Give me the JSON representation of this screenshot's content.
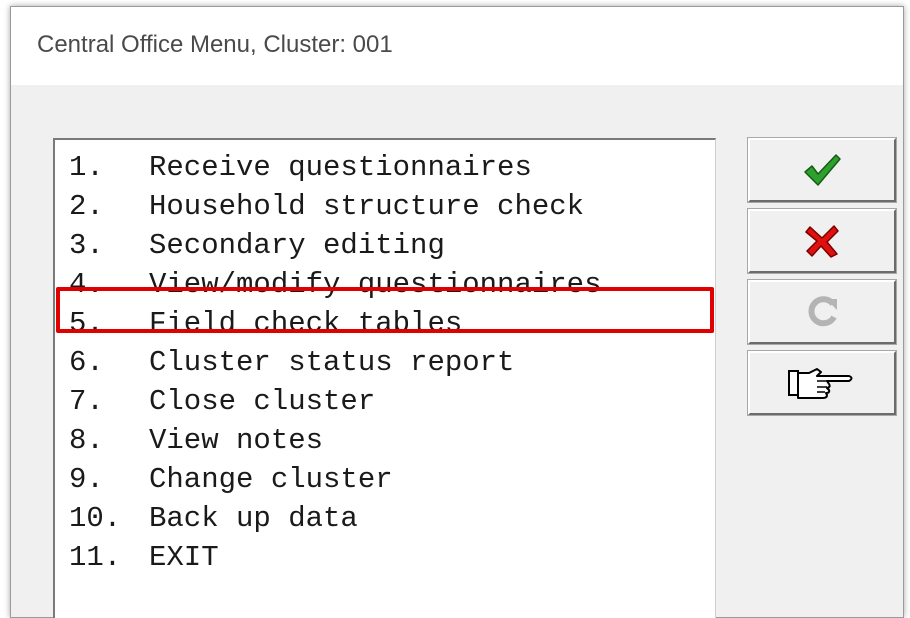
{
  "window": {
    "title": "Central Office Menu, Cluster: 001"
  },
  "menu": {
    "items": [
      {
        "num": "1.",
        "label": "Receive questionnaires"
      },
      {
        "num": "2.",
        "label": "Household structure check"
      },
      {
        "num": "3.",
        "label": "Secondary editing"
      },
      {
        "num": "4.",
        "label": "View/modify questionnaires"
      },
      {
        "num": "5.",
        "label": "Field check tables"
      },
      {
        "num": "6.",
        "label": "Cluster status report"
      },
      {
        "num": "7.",
        "label": "Close cluster"
      },
      {
        "num": "8.",
        "label": "View notes"
      },
      {
        "num": "9.",
        "label": "Change cluster"
      },
      {
        "num": "10.",
        "label": "Back up data"
      },
      {
        "num": "11.",
        "label": "EXIT"
      }
    ],
    "highlighted_index": 4,
    "highlight_color": "#e00000"
  },
  "toolbar": {
    "buttons": [
      {
        "icon": "checkmark-icon",
        "color": "#2ea02e"
      },
      {
        "icon": "cross-icon",
        "color": "#e01010"
      },
      {
        "icon": "refresh-icon",
        "color": "#b4b4b4",
        "disabled": true
      },
      {
        "icon": "pointing-hand-icon",
        "color": "#000000"
      }
    ]
  }
}
